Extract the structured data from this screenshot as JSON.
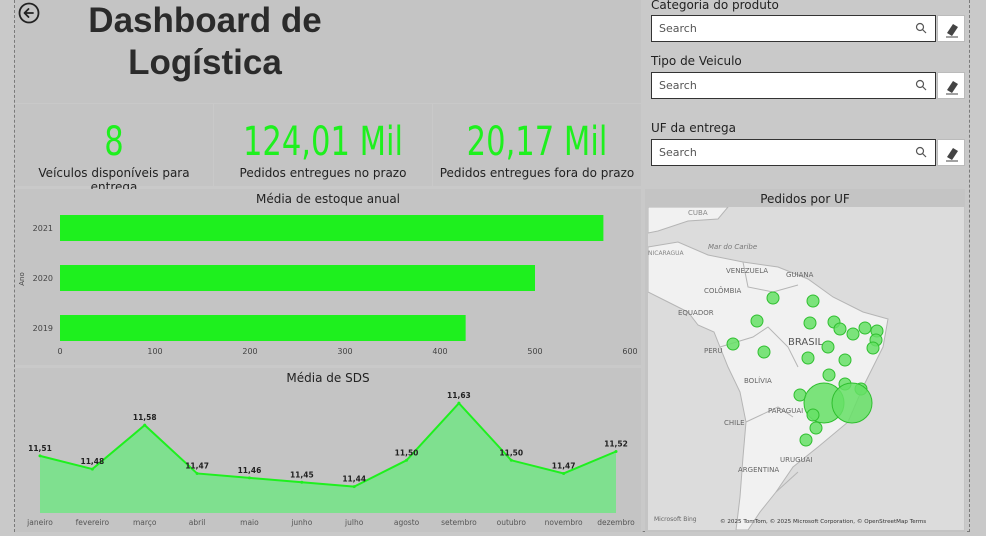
{
  "header": {
    "title_line1": "Dashboard de",
    "title_line2": "Logística"
  },
  "kpis": [
    {
      "value": "8",
      "label": "Veículos disponíveis para entrega"
    },
    {
      "value": "124,01 Mil",
      "label": "Pedidos entregues no prazo"
    },
    {
      "value": "20,17 Mil",
      "label": "Pedidos entregues fora do prazo"
    }
  ],
  "slicers": [
    {
      "label": "Categoria do produto",
      "placeholder": "Search"
    },
    {
      "label": "Tipo de Veiculo",
      "placeholder": "Search"
    },
    {
      "label": "UF da entrega",
      "placeholder": "Search"
    }
  ],
  "colors": {
    "accent": "#1ef01e",
    "area_fill": "#7fe08f",
    "panel": "#c4c4c4"
  },
  "map": {
    "title": "Pedidos por UF",
    "labels": [
      "CUBA",
      "Mar do Caribe",
      "VENEZUELA",
      "GUIANA",
      "COLÔMBIA",
      "EQUADOR",
      "PERU",
      "BRASIL",
      "BOLÍVIA",
      "PARAGUAI",
      "CHILE",
      "URUGUAI",
      "ARGENTINA",
      "NICARAGUA"
    ],
    "attribution": "© 2025 TomTom, © 2025 Microsoft Corporation, © OpenStreetMap  Terms",
    "logo": "Microsoft Bing"
  },
  "chart_data": [
    {
      "type": "bar",
      "orientation": "horizontal",
      "title": "Média de estoque anual",
      "ylabel": "Ano",
      "xlabel": "",
      "categories": [
        "2021",
        "2020",
        "2019"
      ],
      "values": [
        572,
        500,
        427
      ],
      "xlim": [
        0,
        600
      ],
      "xticks": [
        0,
        100,
        200,
        300,
        400,
        500,
        600
      ],
      "grid": false
    },
    {
      "type": "area",
      "title": "Média de SDS",
      "xlabel": "",
      "ylabel": "",
      "categories": [
        "janeiro",
        "fevereiro",
        "março",
        "abril",
        "maio",
        "junho",
        "julho",
        "agosto",
        "setembro",
        "outubro",
        "novembro",
        "dezembro"
      ],
      "values": [
        11.51,
        11.48,
        11.58,
        11.47,
        11.46,
        11.45,
        11.44,
        11.5,
        11.63,
        11.5,
        11.47,
        11.52
      ],
      "value_labels": [
        "11,51",
        "11,48",
        "11,58",
        "11,47",
        "11,46",
        "11,45",
        "11,44",
        "11,50",
        "11,63",
        "11,50",
        "11,47",
        "11,52"
      ],
      "ylim": [
        11.38,
        11.66
      ],
      "grid": false
    }
  ]
}
